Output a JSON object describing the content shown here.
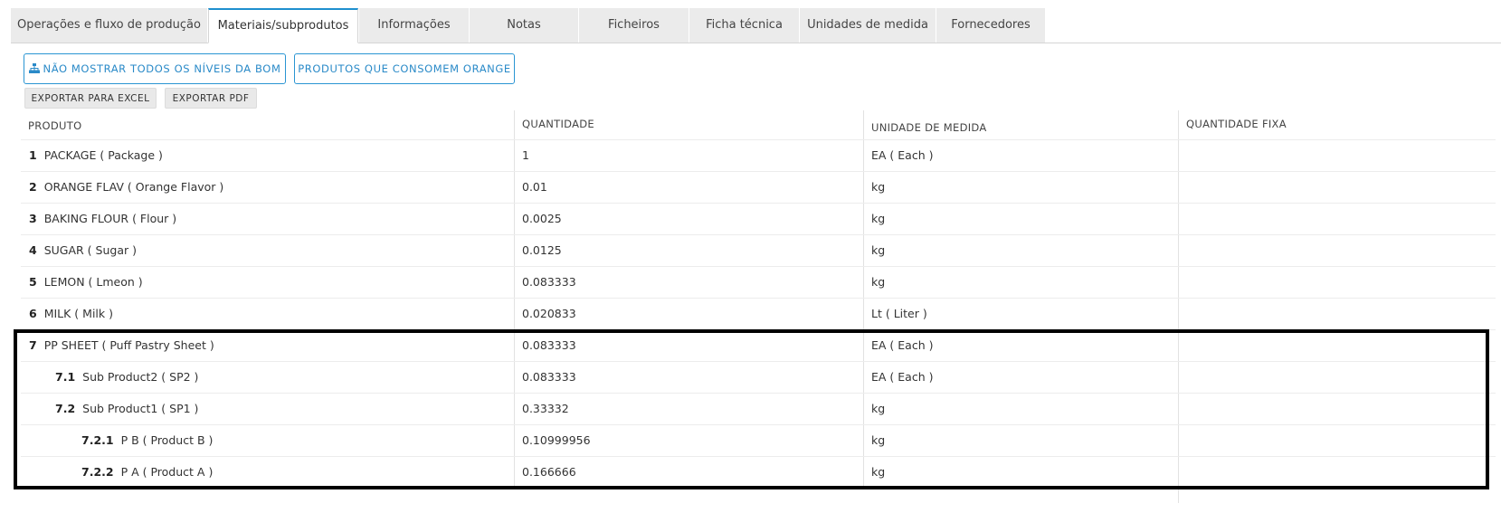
{
  "tabs": [
    {
      "label": "Operações e fluxo de produção"
    },
    {
      "label": "Materiais/subprodutos"
    },
    {
      "label": "Informações"
    },
    {
      "label": "Notas"
    },
    {
      "label": "Ficheiros"
    },
    {
      "label": "Ficha técnica"
    },
    {
      "label": "Unidades de medida"
    },
    {
      "label": "Fornecedores"
    }
  ],
  "active_tab": "Materiais/subprodutos",
  "toolbar": {
    "bom_levels_label": "NÃO MOSTRAR TODOS OS NÍVEIS DA BOM",
    "consumers_label": "PRODUTOS QUE CONSOMEM ORANGE",
    "export_excel_label": "EXPORTAR PARA EXCEL",
    "export_pdf_label": "EXPORTAR PDF"
  },
  "table": {
    "headers": {
      "produto": "PRODUTO",
      "quantidade": "QUANTIDADE",
      "unidade": "UNIDADE DE MEDIDA",
      "fixa": "QUANTIDADE FIXA"
    },
    "rows": [
      {
        "num": "1",
        "name": "PACKAGE ( Package )",
        "qty": "1",
        "unit": "EA ( Each )",
        "fixed": ""
      },
      {
        "num": "2",
        "name": "ORANGE FLAV ( Orange Flavor )",
        "qty": "0.01",
        "unit": "kg",
        "fixed": ""
      },
      {
        "num": "3",
        "name": "BAKING FLOUR ( Flour )",
        "qty": "0.0025",
        "unit": "kg",
        "fixed": ""
      },
      {
        "num": "4",
        "name": "SUGAR ( Sugar )",
        "qty": "0.0125",
        "unit": "kg",
        "fixed": ""
      },
      {
        "num": "5",
        "name": "LEMON ( Lmeon )",
        "qty": "0.083333",
        "unit": "kg",
        "fixed": ""
      },
      {
        "num": "6",
        "name": "MILK ( Milk )",
        "qty": "0.020833",
        "unit": "Lt ( Liter )",
        "fixed": ""
      },
      {
        "num": "7",
        "name": "PP SHEET ( Puff Pastry Sheet )",
        "qty": "0.083333",
        "unit": "EA ( Each )",
        "fixed": ""
      },
      {
        "num": "7.1",
        "name": "Sub Product2 ( SP2 )",
        "qty": "0.083333",
        "unit": "EA ( Each )",
        "fixed": ""
      },
      {
        "num": "7.2",
        "name": "Sub Product1 ( SP1 )",
        "qty": "0.33332",
        "unit": "kg",
        "fixed": ""
      },
      {
        "num": "7.2.1",
        "name": "P B ( Product B )",
        "qty": "0.10999956",
        "unit": "kg",
        "fixed": ""
      },
      {
        "num": "7.2.2",
        "name": "P A ( Product A )",
        "qty": "0.166666",
        "unit": "kg",
        "fixed": ""
      }
    ]
  },
  "colors": {
    "accent": "#2a95d3",
    "highlight": "#000000"
  },
  "icons": {
    "bom_levels": "sitemap-icon"
  }
}
